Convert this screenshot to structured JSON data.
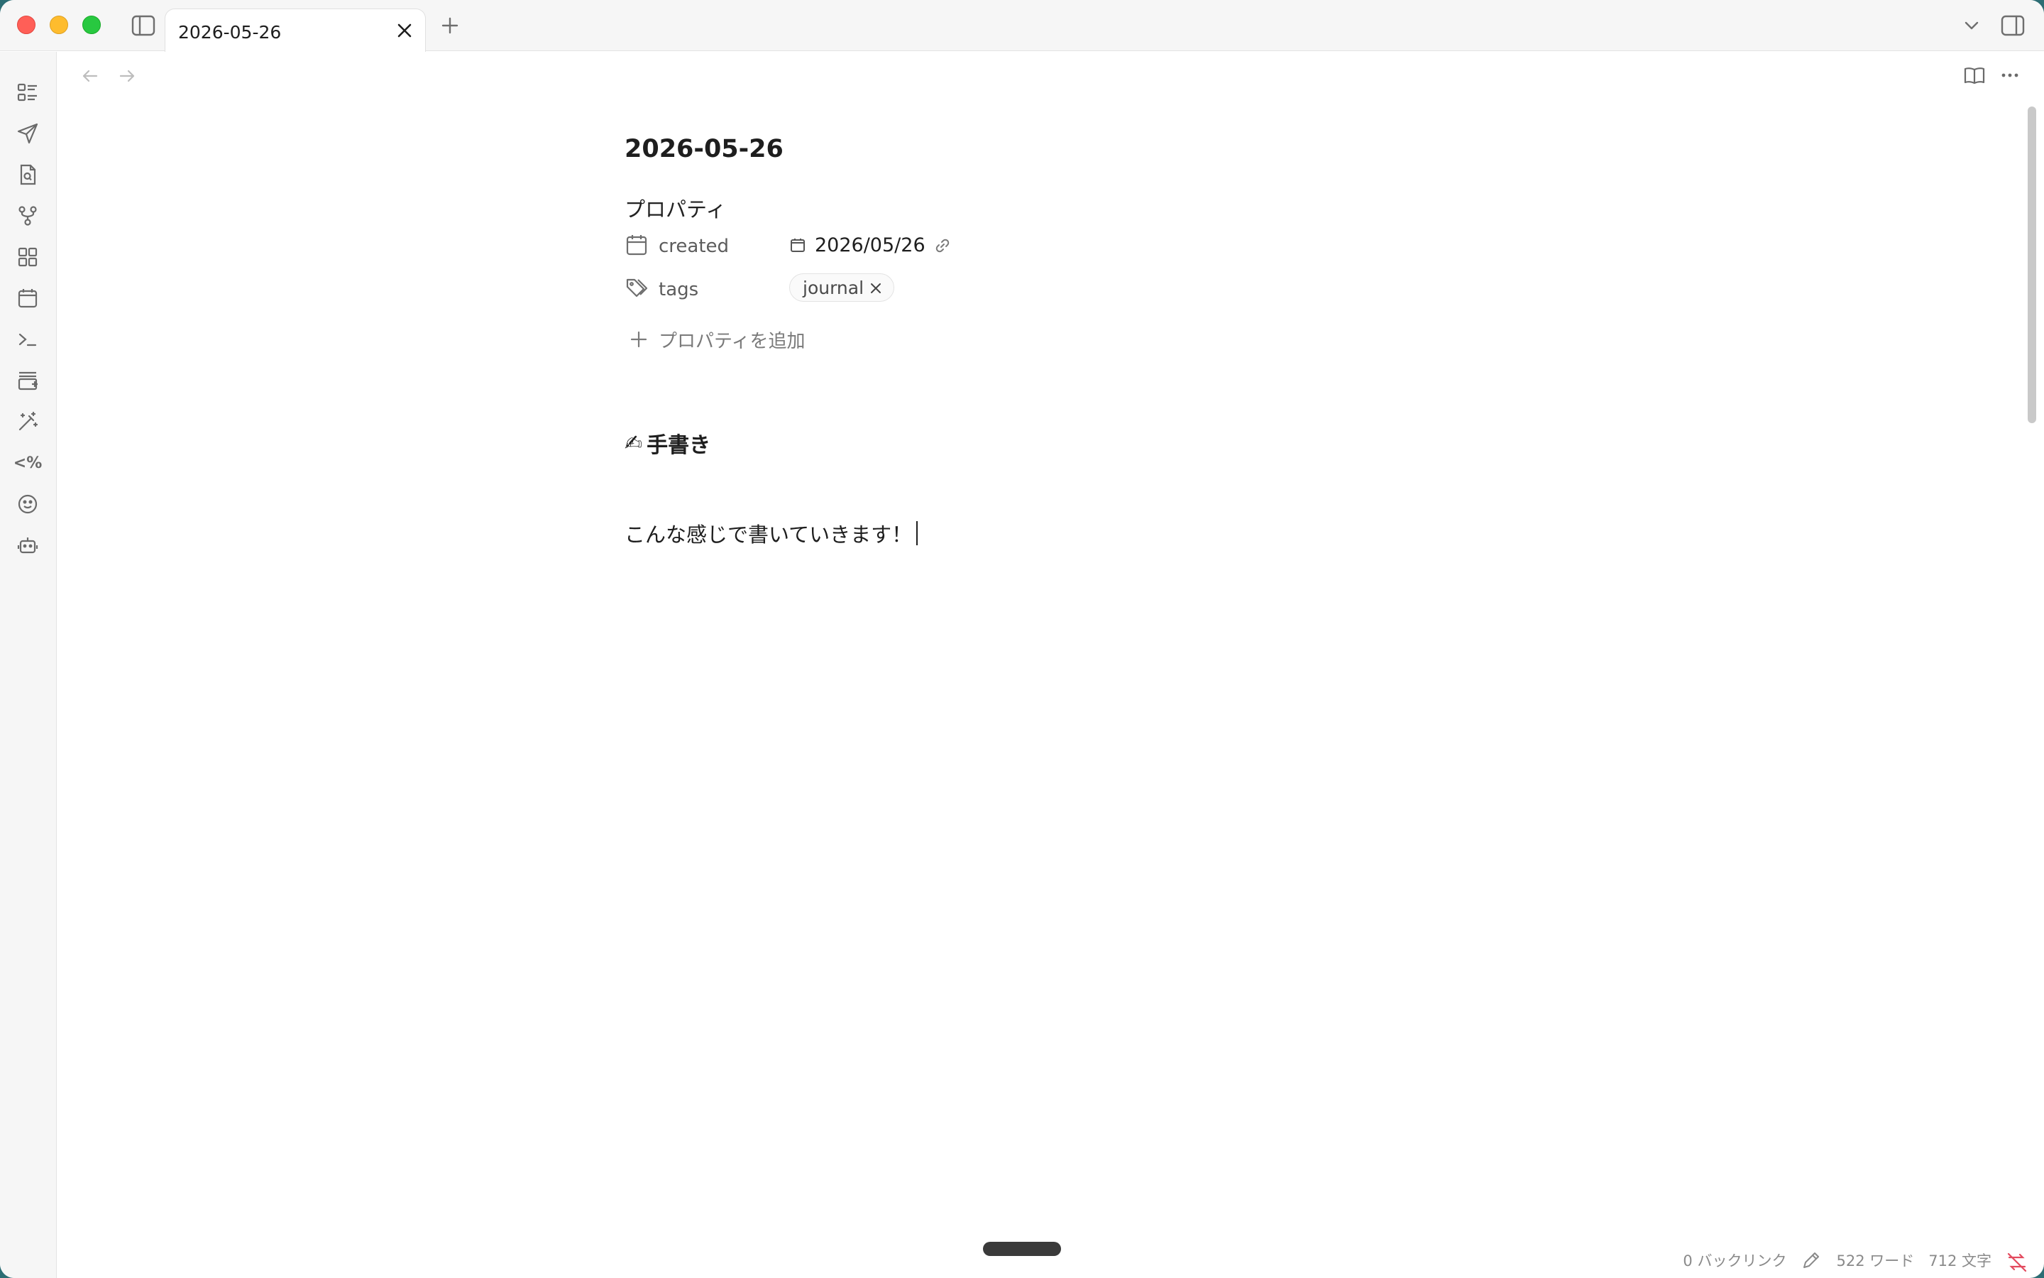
{
  "tab": {
    "title": "2026-05-26"
  },
  "note": {
    "title": "2026-05-26",
    "properties_heading": "プロパティ",
    "properties": [
      {
        "icon": "calendar-icon",
        "key": "created",
        "value": "2026/05/26"
      },
      {
        "icon": "tag-icon",
        "key": "tags",
        "value": "journal"
      }
    ],
    "add_property_label": "プロパティを追加",
    "heading": {
      "emoji": "✍",
      "text": "手書き"
    },
    "paragraph": "こんな感じで書いていきます！"
  },
  "ribbon": {
    "icons": [
      "kanban-icon",
      "send-icon",
      "file-search-icon",
      "git-branch-icon",
      "dashboard-icon",
      "calendar-icon",
      "terminal-icon",
      "template-add-icon",
      "magic-wand-icon",
      "templater-icon",
      "smiley-icon",
      "bot-icon"
    ]
  },
  "status": {
    "backlinks": "0 バックリンク",
    "words": "522 ワード",
    "chars": "712 文字"
  },
  "colors": {
    "close": "#ff5f57",
    "minimize": "#febc2e",
    "maximize": "#28c840",
    "sync_error": "#e34b5f"
  }
}
